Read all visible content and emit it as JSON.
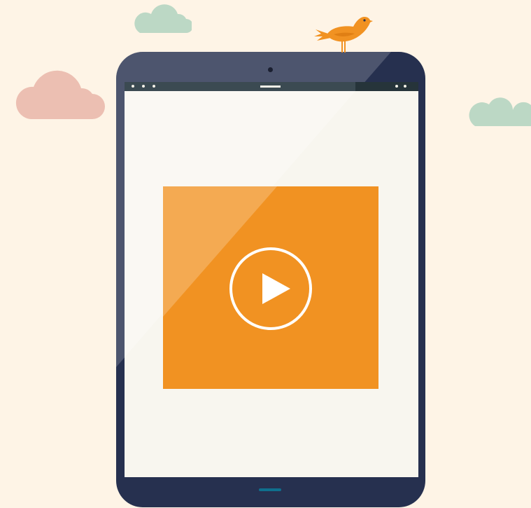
{
  "scene": {
    "background_color": "#fef4e6",
    "tablet_color": "#26304f",
    "screen_color": "#f8f6ef",
    "accent_color": "#f19222",
    "cloud_pink": "#ecbfb2",
    "cloud_green": "#bcd8c5"
  },
  "status_bar": {
    "left_icons": [
      "dot-icon",
      "dot-icon",
      "dot-icon"
    ],
    "right_icons": [
      "dot-icon",
      "dot-icon"
    ]
  },
  "video": {
    "play_icon": "play-icon"
  },
  "decorations": {
    "bird_icon": "bird-icon",
    "cloud_icons": [
      "cloud-icon",
      "cloud-icon",
      "cloud-icon"
    ]
  }
}
